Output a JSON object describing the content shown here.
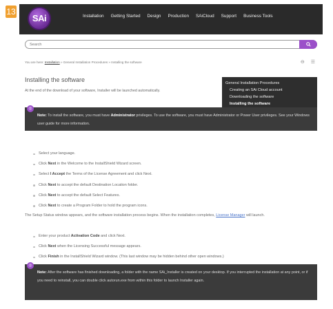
{
  "step_badge": "13",
  "header": {
    "logo_text": "SAi",
    "nav": [
      "Installation",
      "Getting Started",
      "Design",
      "Production",
      "SAiCloud",
      "Support",
      "Business Tools"
    ]
  },
  "search": {
    "placeholder": "Search",
    "button_icon": "search-icon"
  },
  "breadcrumb": {
    "prefix": "You are here: ",
    "link": "Installation",
    "rest": " » General Installation Procedures » Installing the software"
  },
  "toolbar_icons": [
    "print-icon",
    "menu-icon"
  ],
  "page": {
    "title": "Installing the software",
    "intro": "At the end of the download of your software, Installer will be launched automatically."
  },
  "toc": {
    "heading": "General Installation Procedures",
    "items": [
      {
        "label": "Creating an SAi Cloud account",
        "active": false
      },
      {
        "label": "Downloading the software",
        "active": false
      },
      {
        "label": "Installing the software",
        "active": true
      }
    ]
  },
  "note1": {
    "label": "Note:",
    "text_a": " To install the software, you must have ",
    "bold": "Administrator",
    "text_b": " privileges. To use the software, you must have Administrator or Power User privileges. See your Windows user guide for more information."
  },
  "steps1": [
    {
      "pre": "Select your language.",
      "bold": "",
      "post": ""
    },
    {
      "pre": "Click ",
      "bold": "Next",
      "post": " in the Welcome to the InstallShield Wizard screen."
    },
    {
      "pre": "Select ",
      "bold": "I Accept",
      "post": " the Terms of the License Agreement and click Next."
    },
    {
      "pre": "Click ",
      "bold": "Next",
      "post": " to accept the default Destination Location folder."
    },
    {
      "pre": "Click ",
      "bold": "Next",
      "post": " to accept the default Select Features."
    },
    {
      "pre": "Click ",
      "bold": "Next",
      "post": " to create a Program Folder to hold the program icons."
    }
  ],
  "para": {
    "text": "The Setup Status window appears, and the software installation process begins. When the installation completes, ",
    "link": "License Manager",
    "after": " will launch."
  },
  "steps2": [
    {
      "pre": "Enter your product ",
      "bold": "Activation Code",
      "post": " and click Next."
    },
    {
      "pre": "Click ",
      "bold": "Next",
      "post": " when the Licensing Successful message appears."
    },
    {
      "pre": "Click ",
      "bold": "Finish",
      "post": " in the InstallShield Wizard window. (This last window may be hidden behind other open windows.)"
    }
  ],
  "note2": {
    "label": "Note:",
    "text": " After the software has finished downloading, a folder with the name SAi_Installer is created on your desktop. If you interrupted the installation at any point, or if you need to reinstall, you can double click autorun.exe from within this folder to launch Installer again."
  },
  "colors": {
    "accent": "#9b4fc9",
    "header_bg": "#2a2a2a",
    "badge": "#f0a030",
    "link": "#4a74c9"
  }
}
